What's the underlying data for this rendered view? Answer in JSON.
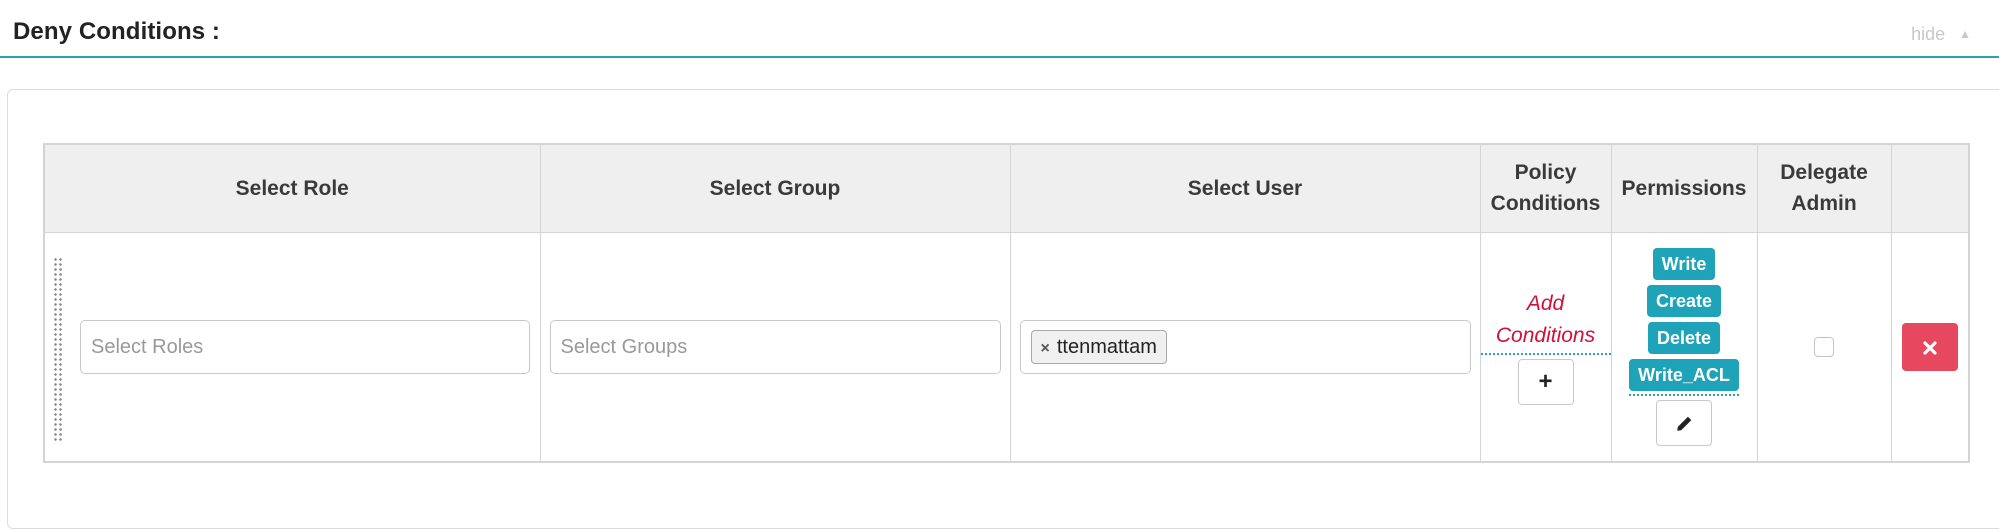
{
  "section": {
    "title": "Deny Conditions :",
    "hide_label": "hide",
    "hide_caret": "▲"
  },
  "table": {
    "headers": {
      "role": "Select Role",
      "group": "Select Group",
      "user": "Select User",
      "policy_conditions": "Policy Conditions",
      "permissions": "Permissions",
      "delegate_admin": "Delegate Admin"
    },
    "row": {
      "roles_placeholder": "Select Roles",
      "groups_placeholder": "Select Groups",
      "user_tag": "ttenmattam",
      "tag_remove": "×",
      "add_conditions": "Add Conditions",
      "add_icon": "+",
      "permissions": [
        "Write",
        "Create",
        "Delete",
        "Write_ACL"
      ],
      "edit_icon": "pencil-icon",
      "delegate_admin_checked": false,
      "delete_icon": "close-icon"
    }
  },
  "colors": {
    "accent": "#2a9fb8",
    "badge": "#1ea3b8",
    "danger": "#e5485f",
    "link": "#d0103a"
  }
}
